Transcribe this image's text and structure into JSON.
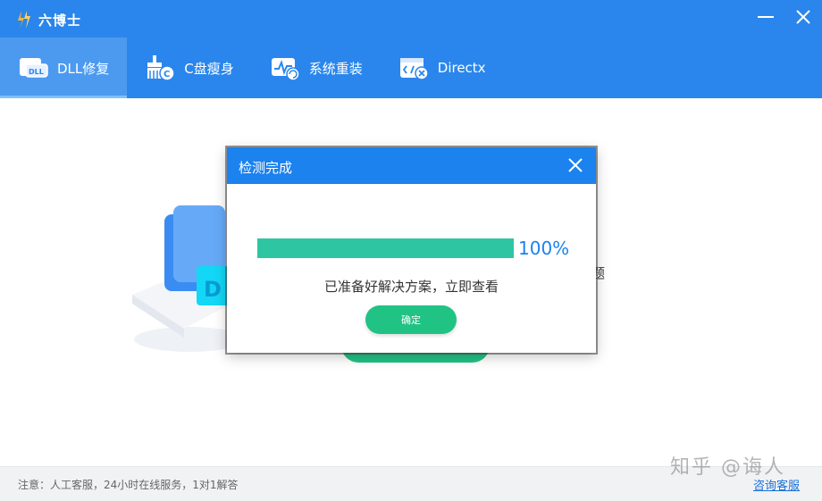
{
  "app": {
    "title": "六博士"
  },
  "window": {
    "minimize_icon": "minimize-icon",
    "close_icon": "close-icon"
  },
  "tabs": [
    {
      "label": "DLL修复",
      "icon": "dll-icon",
      "active": true
    },
    {
      "label": "C盘瘦身",
      "icon": "disk-clean-icon",
      "active": false
    },
    {
      "label": "系统重装",
      "icon": "system-reinstall-icon",
      "active": false
    },
    {
      "label": "Directx",
      "icon": "directx-icon",
      "active": false
    }
  ],
  "background": {
    "partial_text": "题"
  },
  "dialog": {
    "title": "检测完成",
    "progress": 1.0,
    "progress_text": "100%",
    "message": "已准备好解决方案，立即查看",
    "confirm_label": "确定"
  },
  "footer": {
    "note": "注意：人工客服，24小时在线服务，1对1解答",
    "link": "咨询客服"
  },
  "watermark": "知乎 @诲人",
  "colors": {
    "header": "#2a86ec",
    "dialog_header": "#1b82ee",
    "progress": "#2ec6a2",
    "button": "#20c383",
    "link": "#1a6fd8"
  }
}
